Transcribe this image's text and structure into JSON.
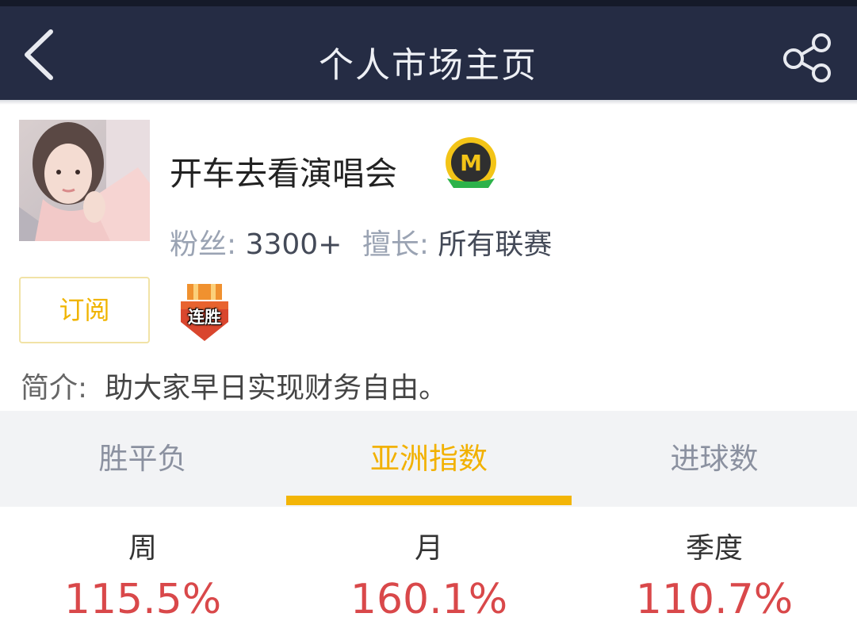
{
  "header": {
    "title": "个人市场主页",
    "back_icon": "chevron-left-icon",
    "share_icon": "share-icon",
    "background": "#252c44"
  },
  "profile": {
    "username": "开车去看演唱会",
    "badge_letter": "M",
    "fans_label": "粉丝:",
    "fans_value": "3300+",
    "specialty_label": "擅长:",
    "specialty_value": "所有联赛",
    "subscribe_label": "订阅",
    "streak_badge_label": "连胜",
    "intro_label": "简介:",
    "intro_text": "助大家早日实现财务自由。"
  },
  "tabs": [
    {
      "label": "胜平负",
      "active": false
    },
    {
      "label": "亚洲指数",
      "active": true
    },
    {
      "label": "进球数",
      "active": false
    }
  ],
  "metrics": [
    {
      "label": "周",
      "value": "115.5%"
    },
    {
      "label": "月",
      "value": "160.1%"
    },
    {
      "label": "季度",
      "value": "110.7%"
    }
  ],
  "colors": {
    "accent": "#f2b100",
    "positive_value": "#d9484a",
    "tab_inactive": "#8b91a0"
  }
}
